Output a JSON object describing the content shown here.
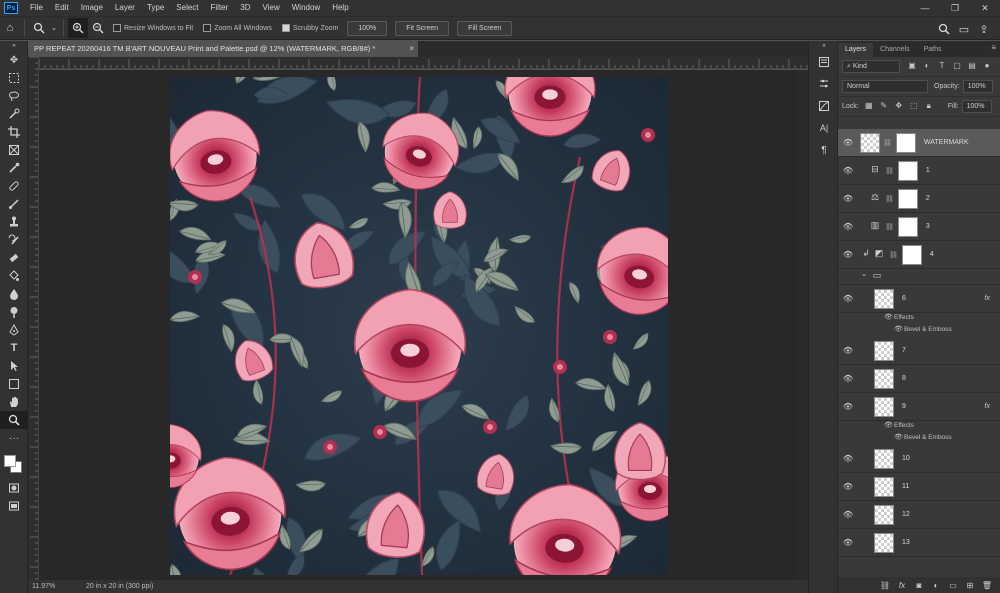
{
  "app": {
    "logo": "Ps"
  },
  "menu": [
    "File",
    "Edit",
    "Image",
    "Layer",
    "Type",
    "Select",
    "Filter",
    "3D",
    "View",
    "Window",
    "Help"
  ],
  "window_controls": {
    "minimize": "—",
    "restore": "❐",
    "close": "✕"
  },
  "options": {
    "resize_windows": "Resize Windows to Fit",
    "zoom_all": "Zoom All Windows",
    "scrubby_zoom": "Scrubby Zoom",
    "btn_100": "100%",
    "btn_fit": "Fit Screen",
    "btn_fill": "Fill Screen"
  },
  "document": {
    "tab_title": "PP REPEAT 20260416 TM B'ART NOUVEAU Print and Palette.psd @ 12% (WATERMARK, RGB/8#) *",
    "close": "×"
  },
  "status": {
    "zoom": "11.97%",
    "doc_size": "20 in x 20 in (300 ppi)"
  },
  "layers_panel": {
    "tabs": [
      "Layers",
      "Channels",
      "Paths"
    ],
    "filter_kind": "Kind",
    "blend_mode": "Normal",
    "opacity_label": "Opacity:",
    "opacity_value": "100%",
    "lock_label": "Lock:",
    "fill_label": "Fill:",
    "fill_value": "100%",
    "layers": [
      {
        "name": "WATERMARK",
        "kind": "thumb+mask",
        "selected": true
      },
      {
        "name": "1",
        "kind": "adjust"
      },
      {
        "name": "2",
        "kind": "adjust"
      },
      {
        "name": "3",
        "kind": "adjust"
      },
      {
        "name": "4",
        "kind": "adjust"
      },
      {
        "name": "",
        "kind": "group"
      },
      {
        "name": "6",
        "kind": "thumb",
        "fx": true
      },
      {
        "name": "7",
        "kind": "thumb"
      },
      {
        "name": "8",
        "kind": "thumb"
      },
      {
        "name": "9",
        "kind": "thumb",
        "fx": true
      },
      {
        "name": "10",
        "kind": "thumb"
      },
      {
        "name": "11",
        "kind": "thumb"
      },
      {
        "name": "12",
        "kind": "thumb"
      },
      {
        "name": "13",
        "kind": "thumb"
      }
    ],
    "effects_label": "Effects",
    "bevel_label": "Bevel & Emboss",
    "fx_label": "fx"
  },
  "colors": {
    "canvas_bg": "#223140",
    "flower_pink": "#e8788f",
    "flower_dark": "#a0213f",
    "leaf": "#8a9a8e"
  }
}
